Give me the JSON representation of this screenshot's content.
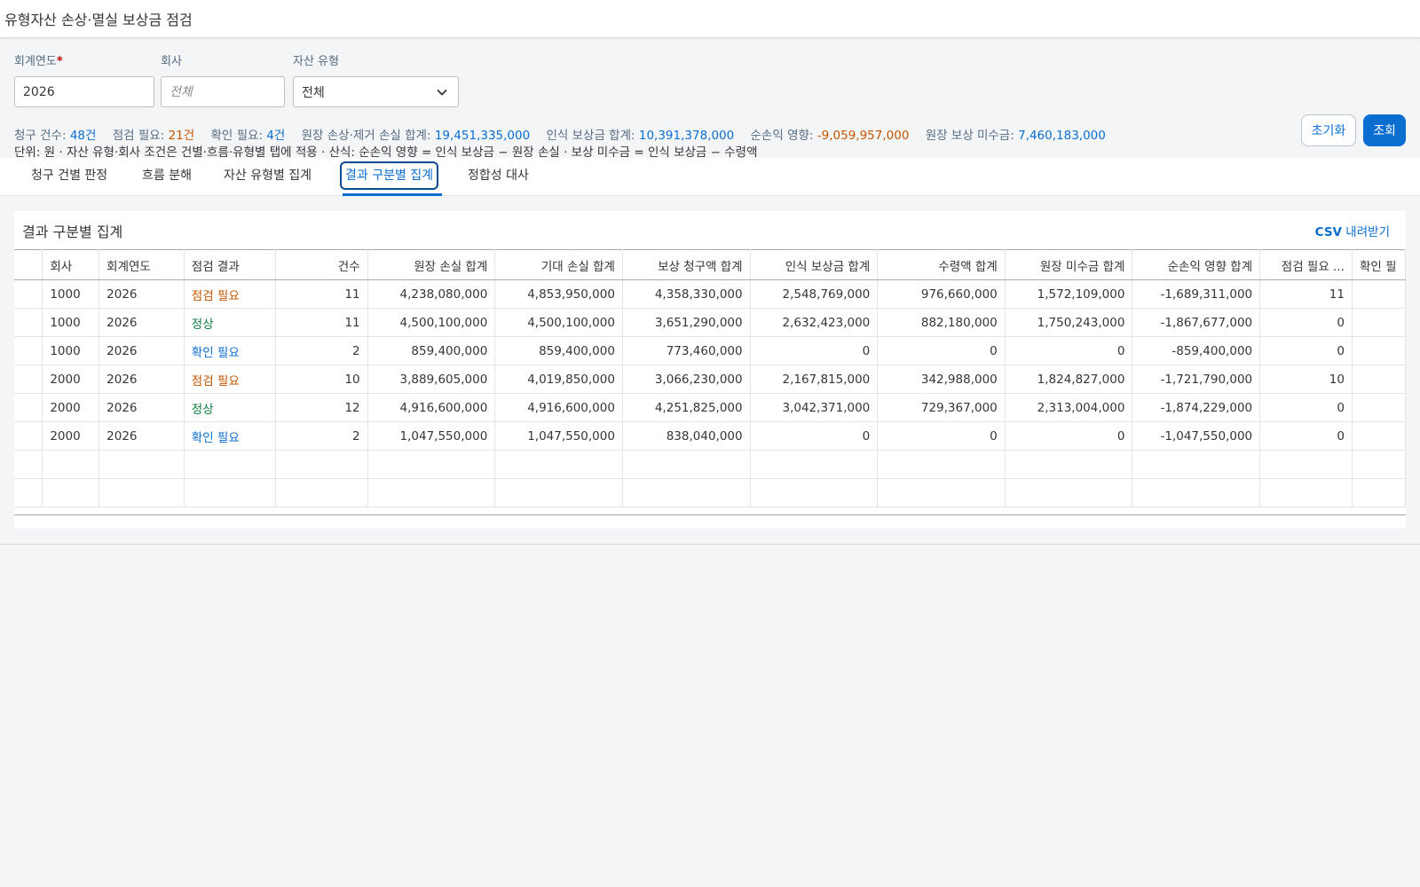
{
  "app": {
    "title": "유형자산 손상·멸실 보상금 점검"
  },
  "filters": {
    "fiscal_year": {
      "label": "회계연도",
      "required_mark": "*",
      "value": "2026"
    },
    "company": {
      "label": "회사",
      "placeholder": "전체",
      "value": ""
    },
    "asset_type": {
      "label": "자산 유형",
      "value": "전체"
    }
  },
  "buttons": {
    "reset": "초기화",
    "search": "조회"
  },
  "summary": {
    "claims": {
      "label": "청구 건수:",
      "value": "48건"
    },
    "check_needed": {
      "label": "점검 필요:",
      "value": "21건"
    },
    "confirm_needed": {
      "label": "확인 필요:",
      "value": "4건"
    },
    "loss_total": {
      "label": "원장 손상·제거 손실 합계:",
      "value": "19,451,335,000"
    },
    "recognized_total": {
      "label": "인식 보상금 합계:",
      "value": "10,391,378,000"
    },
    "net_effect": {
      "label": "순손익 영향:",
      "value": "-9,059,957,000"
    },
    "receivable": {
      "label": "원장 보상 미수금:",
      "value": "7,460,183,000"
    }
  },
  "note": "단위: 원 · 자산 유형·회사 조건은 건별·흐름·유형별 탭에 적용 · 산식: 순손익 영향 = 인식 보상금 − 원장 손실 · 보상 미수금 = 인식 보상금 − 수령액",
  "tabs": [
    {
      "label": "청구 건별 판정"
    },
    {
      "label": "흐름 분해"
    },
    {
      "label": "자산 유형별 집계"
    },
    {
      "label": "결과 구분별 집계"
    },
    {
      "label": "정합성 대사"
    }
  ],
  "panel": {
    "title": "결과 구분별 집계",
    "csv_prefix": "CSV",
    "csv_suffix": " 내려받기"
  },
  "table": {
    "columns": [
      "",
      "회사",
      "회계연도",
      "점검 결과",
      "건수",
      "원장 손실 합계",
      "기대 손실 합계",
      "보상 청구액 합계",
      "인식 보상금 합계",
      "수령액 합계",
      "원장 미수금 합계",
      "순손익 영향 합계",
      "점검 필요 ...",
      "확인 필"
    ],
    "rows": [
      {
        "company": "1000",
        "year": "2026",
        "result": "점검 필요",
        "status": "check",
        "count": "11",
        "ledger_loss": "4,238,080,000",
        "expected_loss": "4,853,950,000",
        "claim": "4,358,330,000",
        "recognized": "2,548,769,000",
        "received": "976,660,000",
        "receivable": "1,572,109,000",
        "net": "-1,689,311,000",
        "check_needed": "11"
      },
      {
        "company": "1000",
        "year": "2026",
        "result": "정상",
        "status": "ok",
        "count": "11",
        "ledger_loss": "4,500,100,000",
        "expected_loss": "4,500,100,000",
        "claim": "3,651,290,000",
        "recognized": "2,632,423,000",
        "received": "882,180,000",
        "receivable": "1,750,243,000",
        "net": "-1,867,677,000",
        "check_needed": "0"
      },
      {
        "company": "1000",
        "year": "2026",
        "result": "확인 필요",
        "status": "confirm",
        "count": "2",
        "ledger_loss": "859,400,000",
        "expected_loss": "859,400,000",
        "claim": "773,460,000",
        "recognized": "0",
        "received": "0",
        "receivable": "0",
        "net": "-859,400,000",
        "check_needed": "0"
      },
      {
        "company": "2000",
        "year": "2026",
        "result": "점검 필요",
        "status": "check",
        "count": "10",
        "ledger_loss": "3,889,605,000",
        "expected_loss": "4,019,850,000",
        "claim": "3,066,230,000",
        "recognized": "2,167,815,000",
        "received": "342,988,000",
        "receivable": "1,824,827,000",
        "net": "-1,721,790,000",
        "check_needed": "10"
      },
      {
        "company": "2000",
        "year": "2026",
        "result": "정상",
        "status": "ok",
        "count": "12",
        "ledger_loss": "4,916,600,000",
        "expected_loss": "4,916,600,000",
        "claim": "4,251,825,000",
        "recognized": "3,042,371,000",
        "received": "729,367,000",
        "receivable": "2,313,004,000",
        "net": "-1,874,229,000",
        "check_needed": "0"
      },
      {
        "company": "2000",
        "year": "2026",
        "result": "확인 필요",
        "status": "confirm",
        "count": "2",
        "ledger_loss": "1,047,550,000",
        "expected_loss": "1,047,550,000",
        "claim": "838,040,000",
        "recognized": "0",
        "received": "0",
        "receivable": "0",
        "net": "-1,047,550,000",
        "check_needed": "0"
      }
    ],
    "empty_rows": 2
  },
  "colors": {
    "accent": "#0a6ed1",
    "warning": "#c35500",
    "success": "#107e3e"
  },
  "icons": {
    "dropdown": "chevron-down-icon"
  }
}
